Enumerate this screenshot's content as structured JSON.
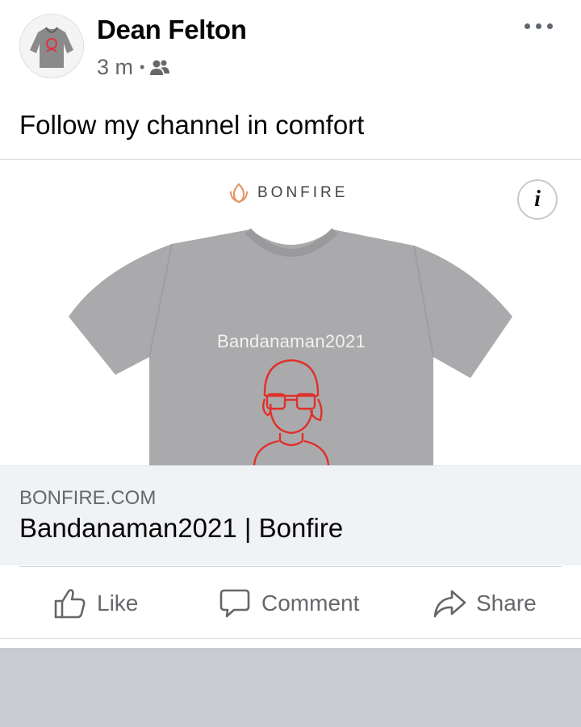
{
  "post": {
    "author": "Dean Felton",
    "time": "3 m",
    "audience_icon": "friends-icon",
    "caption": "Follow my channel in comfort"
  },
  "media": {
    "brand": "BONFIRE",
    "shirt_text": "Bandanaman2021",
    "info_label": "i"
  },
  "link": {
    "domain": "BONFIRE.COM",
    "title": "Bandanaman2021 | Bonfire"
  },
  "actions": {
    "like": "Like",
    "comment": "Comment",
    "share": "Share"
  },
  "colors": {
    "secondary_text": "#65676b",
    "link_bg": "#f0f2f5",
    "shirt": "#a9a9ab",
    "print": "#e0302a",
    "brand_logo": "#e8915f"
  }
}
